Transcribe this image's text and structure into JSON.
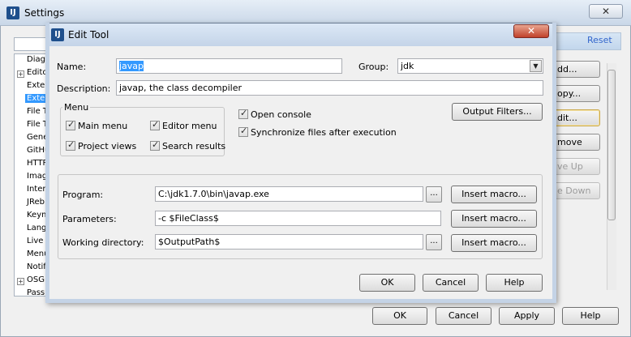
{
  "settings": {
    "title": "Settings",
    "close_glyph": "✕",
    "reset_label": "Reset",
    "tree_items": [
      {
        "label": "Diag",
        "expander": ""
      },
      {
        "label": "Edito",
        "expander": "+"
      },
      {
        "label": "Exte",
        "expander": ""
      },
      {
        "label": "Exte",
        "expander": "",
        "selected": true
      },
      {
        "label": "File T",
        "expander": ""
      },
      {
        "label": "File T",
        "expander": ""
      },
      {
        "label": "Gene",
        "expander": ""
      },
      {
        "label": "GitHu",
        "expander": ""
      },
      {
        "label": "HTTP",
        "expander": ""
      },
      {
        "label": "Imag",
        "expander": ""
      },
      {
        "label": "Inter",
        "expander": ""
      },
      {
        "label": "JReb",
        "expander": ""
      },
      {
        "label": "Keym",
        "expander": ""
      },
      {
        "label": "Lang",
        "expander": ""
      },
      {
        "label": "Live",
        "expander": ""
      },
      {
        "label": "Menu",
        "expander": ""
      },
      {
        "label": "Notif",
        "expander": ""
      },
      {
        "label": "OSG",
        "expander": "+"
      },
      {
        "label": "Pass",
        "expander": ""
      }
    ],
    "side_buttons": [
      {
        "label": "dd...",
        "disabled": false,
        "focused": false
      },
      {
        "label": "opy...",
        "disabled": false,
        "focused": false
      },
      {
        "label": "dit...",
        "disabled": false,
        "focused": true
      },
      {
        "label": "move",
        "disabled": false,
        "focused": false
      },
      {
        "label": "ve Up",
        "disabled": true,
        "focused": false
      },
      {
        "label": "e Down",
        "disabled": true,
        "focused": false
      }
    ],
    "bottom_buttons": {
      "ok": "OK",
      "cancel": "Cancel",
      "apply": "Apply",
      "help": "Help"
    }
  },
  "dialog": {
    "title": "Edit Tool",
    "close_glyph": "✕",
    "name_label": "Name:",
    "name_value": "javap",
    "group_label": "Group:",
    "group_value": "jdk",
    "description_label": "Description:",
    "description_value": "javap, the class decompiler",
    "menu_group": {
      "caption": "Menu",
      "items": [
        {
          "label": "Main menu",
          "checked": true
        },
        {
          "label": "Editor menu",
          "checked": true
        },
        {
          "label": "Project views",
          "checked": true
        },
        {
          "label": "Search results",
          "checked": true
        }
      ]
    },
    "open_console_label": "Open console",
    "open_console_checked": true,
    "sync_files_label": "Synchronize files after execution",
    "sync_files_checked": true,
    "output_filters_label": "Output Filters...",
    "program_label": "Program:",
    "program_value": "C:\\jdk1.7.0\\bin\\javap.exe",
    "parameters_label": "Parameters:",
    "parameters_value": "-c $FileClass$",
    "working_dir_label": "Working directory:",
    "working_dir_value": "$OutputPath$",
    "browse_label": "...",
    "insert_macro_label": "Insert macro...",
    "ok_label": "OK",
    "cancel_label": "Cancel",
    "help_label": "Help"
  }
}
